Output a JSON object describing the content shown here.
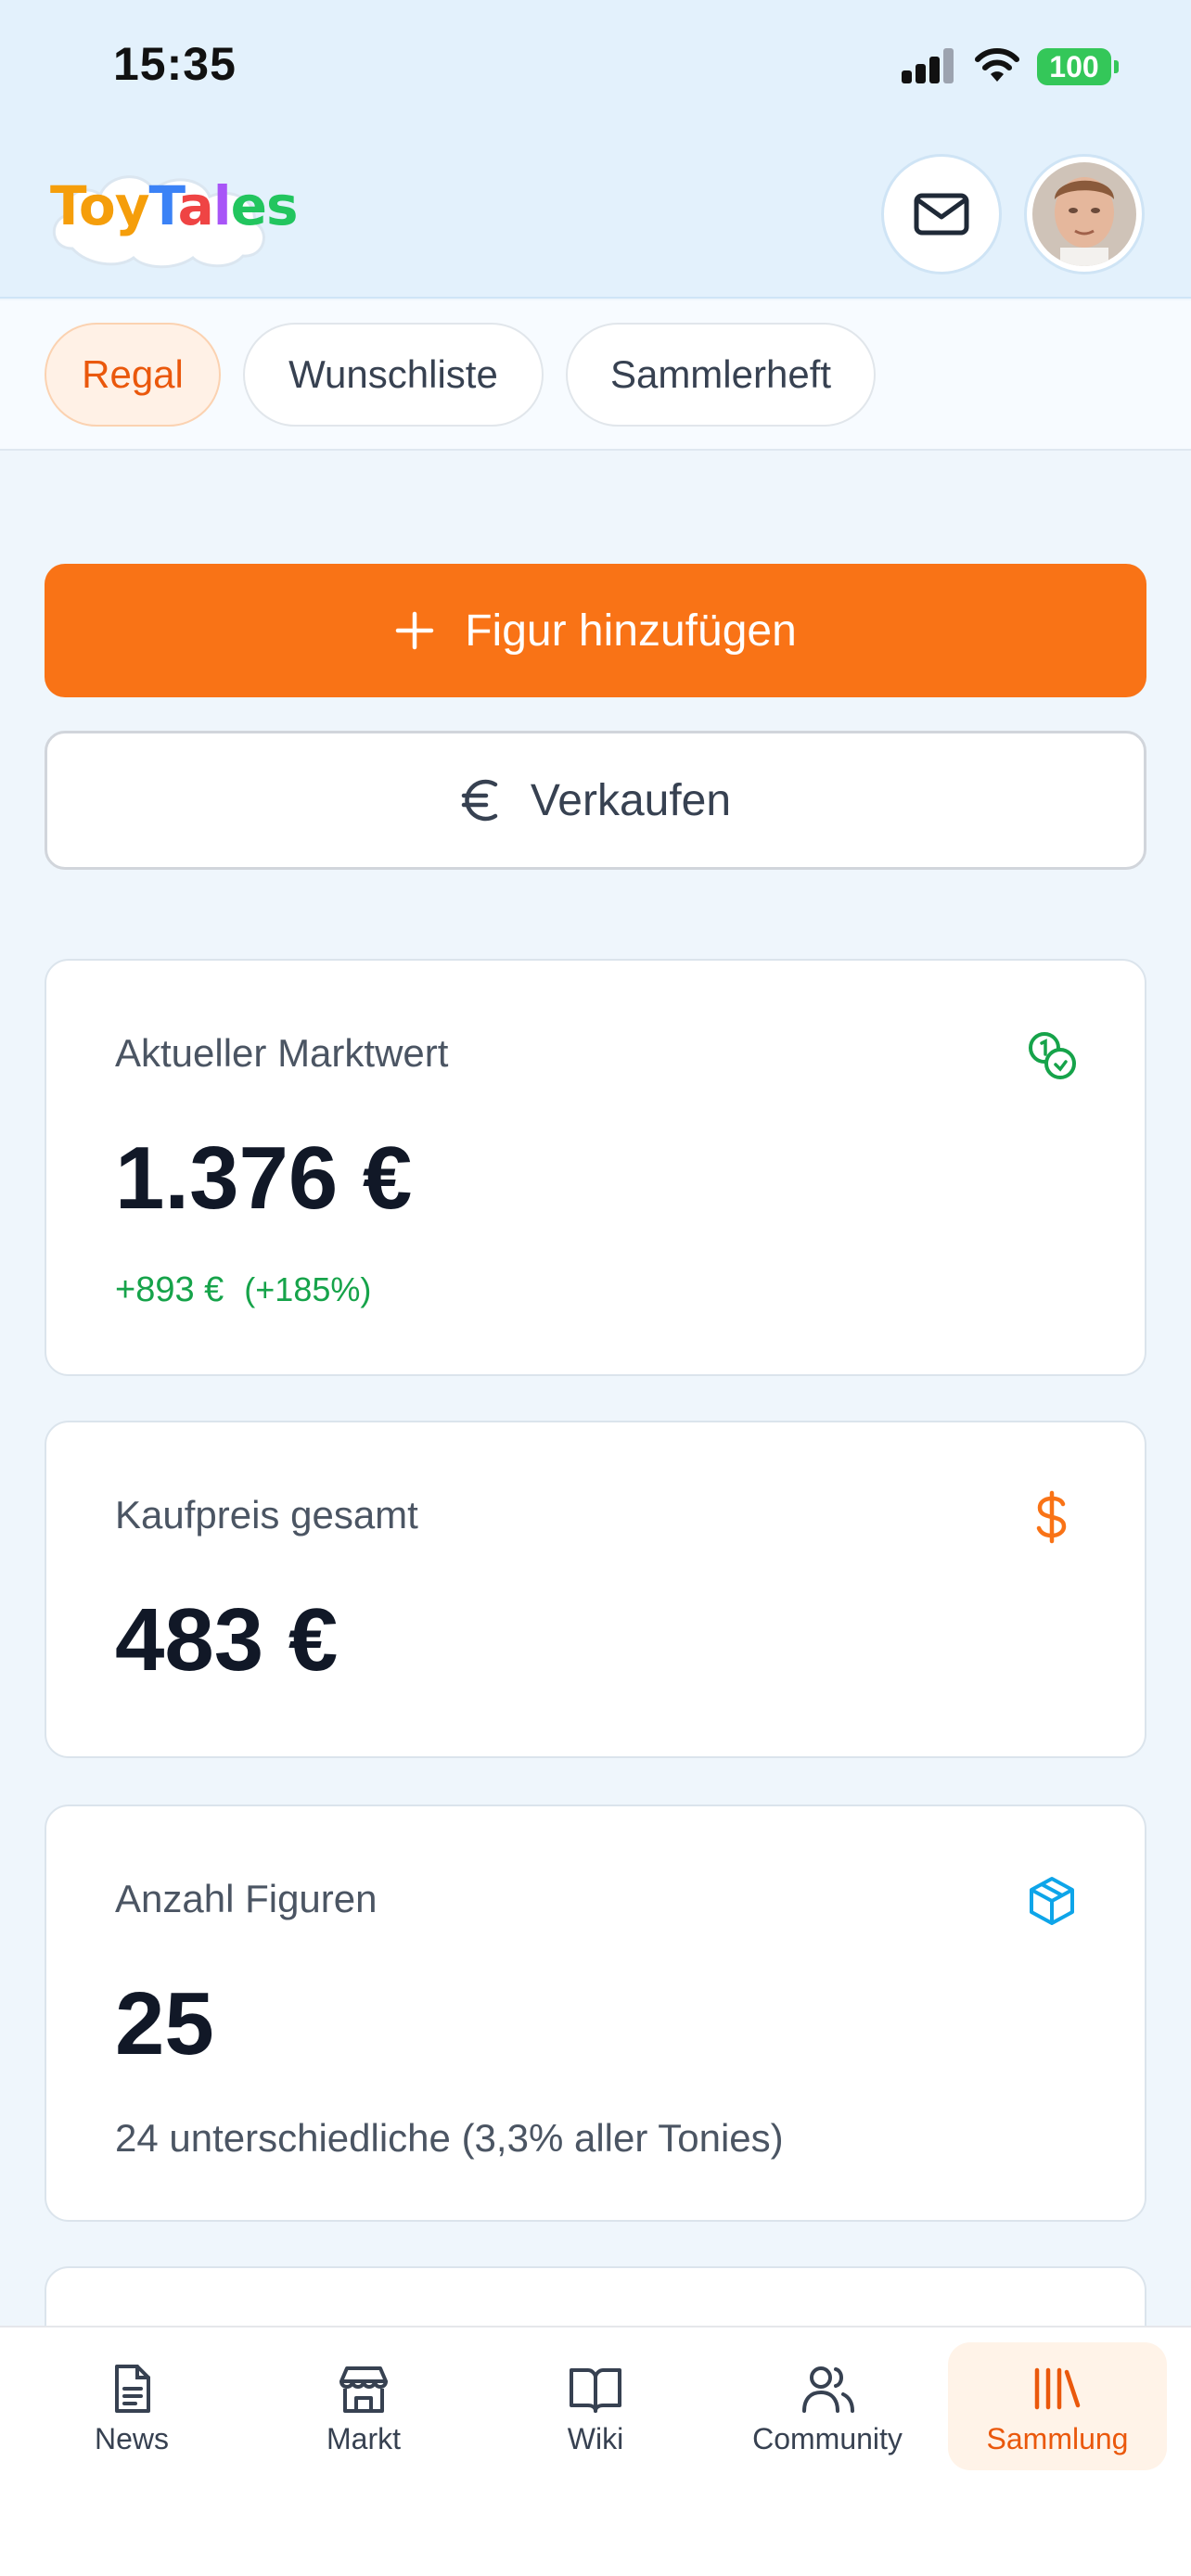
{
  "status_bar": {
    "time": "15:35",
    "battery": "100"
  },
  "header": {
    "logo_text": "ToyTales",
    "mail_icon": "mail-icon",
    "avatar": "user-avatar"
  },
  "tabs": [
    {
      "label": "Regal",
      "active": true
    },
    {
      "label": "Wunschliste",
      "active": false
    },
    {
      "label": "Sammlerheft",
      "active": false
    }
  ],
  "actions": {
    "add_label": "Figur hinzufügen",
    "sell_label": "Verkaufen"
  },
  "cards": {
    "market": {
      "label": "Aktueller Marktwert",
      "value": "1.376 €",
      "change": "+893 €",
      "percent": "(+185%)",
      "icon": "coins-icon"
    },
    "purchase": {
      "label": "Kaufpreis gesamt",
      "value": "483 €",
      "icon": "dollar-icon"
    },
    "count": {
      "label": "Anzahl Figuren",
      "value": "25",
      "sub": "24 unterschiedliche (3,3% aller Tonies)",
      "icon": "box-icon"
    }
  },
  "colors": {
    "accent": "#f97316",
    "positive": "#16a34a",
    "cube": "#0ea5e9"
  },
  "nav": [
    {
      "label": "News",
      "icon": "news-icon",
      "active": false
    },
    {
      "label": "Markt",
      "icon": "store-icon",
      "active": false
    },
    {
      "label": "Wiki",
      "icon": "book-icon",
      "active": false
    },
    {
      "label": "Community",
      "icon": "users-icon",
      "active": false
    },
    {
      "label": "Sammlung",
      "icon": "library-icon",
      "active": true
    }
  ]
}
